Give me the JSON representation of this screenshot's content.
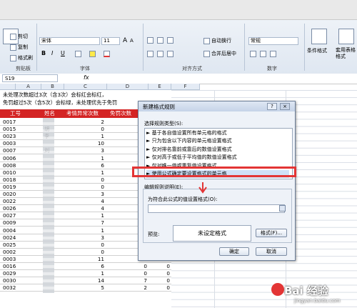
{
  "ribbon": {
    "clipboard": {
      "cut": "剪切",
      "copy": "复制",
      "format_painter": "格式刷",
      "group": "剪贴板"
    },
    "font": {
      "name": "宋体",
      "size": "11",
      "bold": "B",
      "italic": "I",
      "underline": "U",
      "group": "字体"
    },
    "alignment": {
      "wrap": "自动换行",
      "merge": "合并后居中",
      "group": "对齐方式"
    },
    "number": {
      "format": "常规",
      "group": "数字"
    },
    "styles": {
      "conditional": "条件格式",
      "table": "套用表格格式"
    },
    "grow_font": "A",
    "shrink_font": "A"
  },
  "formula_bar": {
    "cell_ref": "S19",
    "fx": "fx"
  },
  "columns": [
    "A",
    "B",
    "C",
    "D",
    "E",
    "F"
  ],
  "sheet": {
    "note1": "未处理次数超过3次（含3次）会标红会标红，",
    "note2": "免罚超过5次（含5次）会标绿，未处理优先于免罚",
    "headers": [
      "工号",
      "姓名",
      "考情异常次数",
      "免罚次数"
    ],
    "rows": [
      {
        "id": "0017",
        "name": "",
        "c": "2",
        "d": "0"
      },
      {
        "id": "0015",
        "name": "胡",
        "c": "0",
        "d": "0"
      },
      {
        "id": "0023",
        "name": "李",
        "c": "1",
        "d": "0"
      },
      {
        "id": "0003",
        "name": "",
        "c": "10",
        "d": "3"
      },
      {
        "id": "0007",
        "name": "刘",
        "c": "3",
        "d": ""
      },
      {
        "id": "0006",
        "name": "",
        "c": "1",
        "d": ""
      },
      {
        "id": "0008",
        "name": "",
        "c": "6",
        "d": ""
      },
      {
        "id": "0010",
        "name": "",
        "c": "1",
        "d": ""
      },
      {
        "id": "0018",
        "name": "",
        "c": "0",
        "d": ""
      },
      {
        "id": "0019",
        "name": "",
        "c": "0",
        "d": ""
      },
      {
        "id": "0020",
        "name": "",
        "c": "3",
        "d": ""
      },
      {
        "id": "0022",
        "name": "",
        "c": "4",
        "d": ""
      },
      {
        "id": "0026",
        "name": "",
        "c": "4",
        "d": ""
      },
      {
        "id": "0027",
        "name": "",
        "c": "1",
        "d": ""
      },
      {
        "id": "0009",
        "name": "",
        "c": "7",
        "d": ""
      },
      {
        "id": "0004",
        "name": "",
        "c": "1",
        "d": ""
      },
      {
        "id": "0024",
        "name": "",
        "c": "3",
        "d": ""
      },
      {
        "id": "0025",
        "name": "",
        "c": "0",
        "d": ""
      },
      {
        "id": "0002",
        "name": "",
        "c": "0",
        "d": "0"
      },
      {
        "id": "0003",
        "name": "",
        "c": "11",
        "d": "5"
      },
      {
        "id": "0016",
        "name": "",
        "c": "6",
        "d": "0"
      },
      {
        "id": "0029",
        "name": "",
        "c": "1",
        "d": "0"
      },
      {
        "id": "0030",
        "name": "",
        "c": "14",
        "d": "7"
      },
      {
        "id": "0032",
        "name": "",
        "c": "5",
        "d": "2"
      }
    ],
    "col_e_values": [
      "0",
      "0",
      "0",
      "0",
      "0",
      "0"
    ]
  },
  "dialog": {
    "title": "新建格式规则",
    "help": "?",
    "close": "×",
    "select_type_label": "选择规则类型(S):",
    "rule_types": [
      "► 基于各自值设置所有单元格的格式",
      "► 只为包含以下内容的单元格设置格式",
      "► 仅对排名靠前或靠后的数值设置格式",
      "► 仅对高于或低于平均值的数值设置格式",
      "► 仅对唯一值或重复值设置格式",
      "► 使用公式确定要设置格式的单元格"
    ],
    "edit_label": "编辑规则说明(E):",
    "formula_label": "为符合此公式的值设置格式(O):",
    "formula_value": "",
    "preview_label": "预览:",
    "preview_text": "未设定格式",
    "format_button": "格式(F)...",
    "ok": "确定",
    "cancel": "取消"
  },
  "watermark": {
    "brand": "Bai 经验",
    "url": "jingyan.baidu.com"
  },
  "colors": {
    "header_red": "#d42424",
    "highlight_red": "#e33535",
    "ribbon": "#dfe7f1"
  }
}
